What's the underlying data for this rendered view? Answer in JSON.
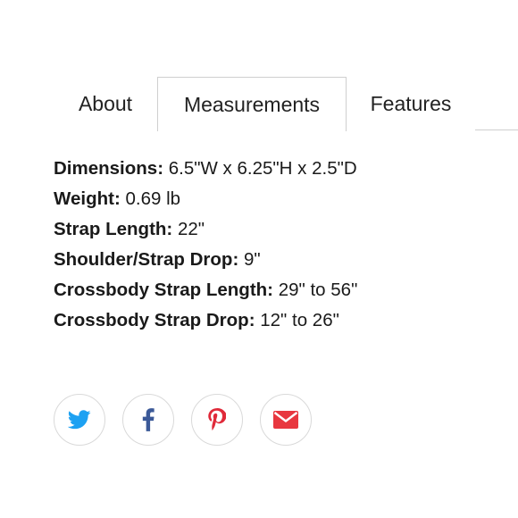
{
  "tabs": [
    {
      "label": "About"
    },
    {
      "label": "Measurements"
    },
    {
      "label": "Features"
    }
  ],
  "active_tab": "Measurements",
  "specs": [
    {
      "key": "Dimensions:",
      "value": " 6.5\"W x 6.25\"H x 2.5\"D"
    },
    {
      "key": "Weight:",
      "value": " 0.69 lb"
    },
    {
      "key": "Strap Length:",
      "value": " 22\""
    },
    {
      "key": "Shoulder/Strap Drop:",
      "value": " 9\""
    },
    {
      "key": "Crossbody Strap Length:",
      "value": " 29\" to 56\""
    },
    {
      "key": "Crossbody Strap Drop:",
      "value": " 12\" to 26\""
    }
  ],
  "share_icons": [
    "twitter-icon",
    "facebook-icon",
    "pinterest-icon",
    "email-icon"
  ],
  "colors": {
    "twitter": "#1da1f2",
    "facebook": "#3b5998",
    "pinterest": "#e02a3a",
    "email": "#e8373f",
    "border": "#cfcfcf"
  }
}
